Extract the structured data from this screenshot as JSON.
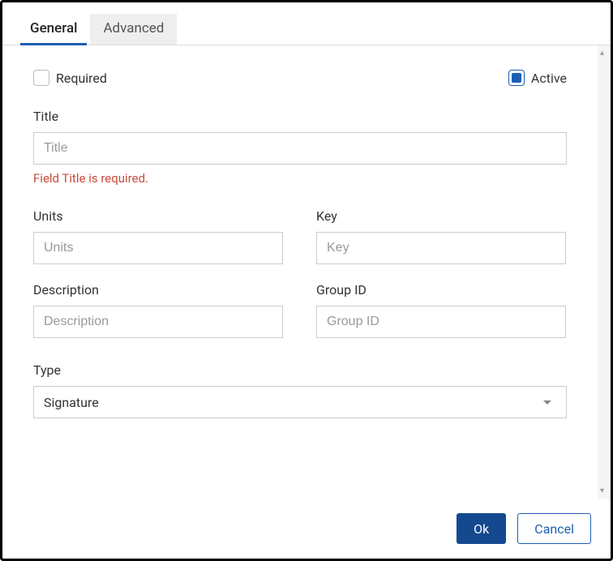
{
  "tabs": {
    "general": "General",
    "advanced": "Advanced"
  },
  "checkboxes": {
    "required_label": "Required",
    "required_checked": false,
    "active_label": "Active",
    "active_checked": true
  },
  "fields": {
    "title": {
      "label": "Title",
      "placeholder": "Title",
      "value": "",
      "error": "Field Title is required."
    },
    "units": {
      "label": "Units",
      "placeholder": "Units",
      "value": ""
    },
    "key": {
      "label": "Key",
      "placeholder": "Key",
      "value": ""
    },
    "description": {
      "label": "Description",
      "placeholder": "Description",
      "value": ""
    },
    "group_id": {
      "label": "Group ID",
      "placeholder": "Group ID",
      "value": ""
    },
    "type": {
      "label": "Type",
      "selected": "Signature"
    }
  },
  "buttons": {
    "ok": "Ok",
    "cancel": "Cancel"
  }
}
